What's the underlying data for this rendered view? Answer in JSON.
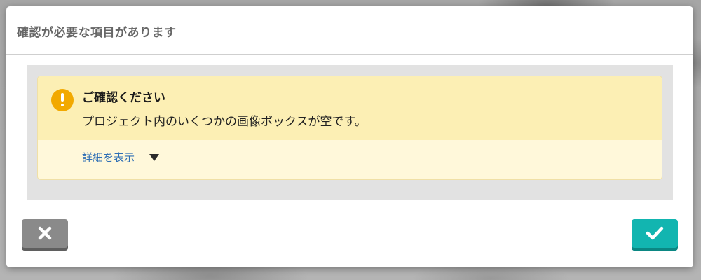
{
  "dialog": {
    "title": "確認が必要な項目があります"
  },
  "alert": {
    "icon": "warning-icon",
    "title": "ご確認ください",
    "message": "プロジェクト内のいくつかの画像ボックスが空です。",
    "details_link": "詳細を表示",
    "details_toggle_icon": "caret-down-icon"
  },
  "buttons": {
    "cancel_icon": "close-icon",
    "confirm_icon": "check-icon"
  },
  "colors": {
    "alert_header_bg": "#fcefb4",
    "alert_footer_bg": "#fff8da",
    "warning_icon": "#f2a900",
    "link": "#2f6fb5",
    "cancel_button": "#8a8a8a",
    "confirm_button": "#12b5b0"
  }
}
